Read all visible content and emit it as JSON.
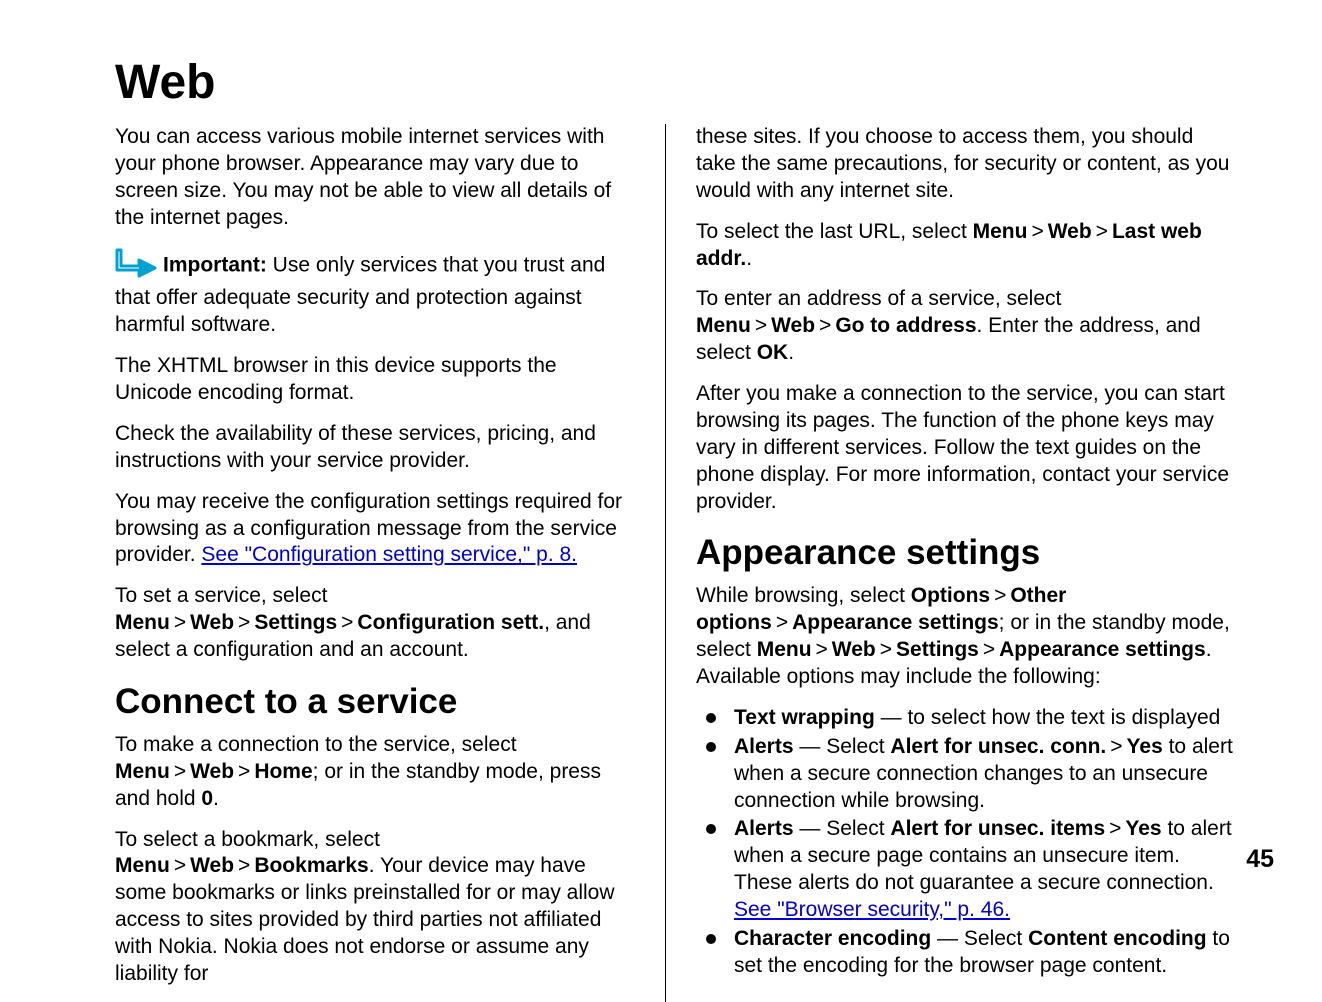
{
  "title": "Web",
  "page_number": "45",
  "left": {
    "p1": "You can access various mobile internet services with your phone browser. Appearance may vary due to screen size. You may not be able to view all details of the internet pages.",
    "important_label": "Important:",
    "important_body": "  Use only services that you trust and that offer adequate security and protection against harmful software.",
    "p2": "The XHTML browser in this device supports the Unicode encoding format.",
    "p3": "Check the availability of these services, pricing, and instructions with your service provider.",
    "p4a": "You may receive the configuration settings required for browsing as a configuration message from the service provider. ",
    "p4_link": "See \"Configuration setting service,\" p. 8.",
    "set_svc_pre": "To set a service, select ",
    "menu": "Menu",
    "web": "Web",
    "settings": "Settings",
    "config_sett": "Configuration sett.",
    "set_svc_post": ", and select a configuration and an account.",
    "h2_connect": "Connect to a service",
    "conn1_pre": "To make a connection to the service, select ",
    "home": "Home",
    "conn1_post": "; or in the standby mode, press and hold ",
    "zero": "0",
    "period": ".",
    "bookmark_pre": "To select a bookmark, select ",
    "bookmarks": "Bookmarks",
    "bookmark_body": ". Your device may have some bookmarks or links preinstalled for or may allow access to sites provided by third parties not affiliated with Nokia. Nokia does not endorse or assume any liability for"
  },
  "right": {
    "p1": "these sites. If you choose to access them, you should take the same precautions, for security or content, as you would with any internet site.",
    "lasturl_pre": "To select the last URL, select ",
    "lastwebaddr": "Last web addr.",
    "enteraddr_pre": "To enter an address of a service, select ",
    "go_to_address": "Go to address",
    "enteraddr_mid": ". Enter the address, and select ",
    "ok": "OK",
    "p2": "After you make a connection to the service, you can start browsing its pages. The function of the phone keys may vary in different services. Follow the text guides on the phone display. For more information, contact your service provider.",
    "h2_appearance": "Appearance settings",
    "app_pre": "While browsing, select ",
    "options": "Options",
    "other_options": "Other options",
    "appearance_settings": "Appearance settings",
    "app_mid": "; or in the standby mode, select ",
    "app_post": ". Available options may include the following:",
    "li1_label": "Text wrapping",
    "li1_body": "  — to select how the text is displayed",
    "li2_label": "Alerts",
    "li2_sel": "Alert for unsec. conn.",
    "yes": "Yes",
    "li2_body": " to alert when a secure connection changes to an unsecure connection while browsing.",
    "li3_sel": "Alert for unsec. items",
    "li3_body": " to alert when a secure page contains an unsecure item. These alerts do not guarantee a secure connection. ",
    "li3_link": "See \"Browser security,\" p. 46.",
    "li4_label": "Character encoding",
    "li4_sel": "Content encoding",
    "li4_body": " to set the encoding for the browser page content.",
    "dash": "  — Select ",
    "select_sp": " — Select "
  },
  "gt": ">"
}
